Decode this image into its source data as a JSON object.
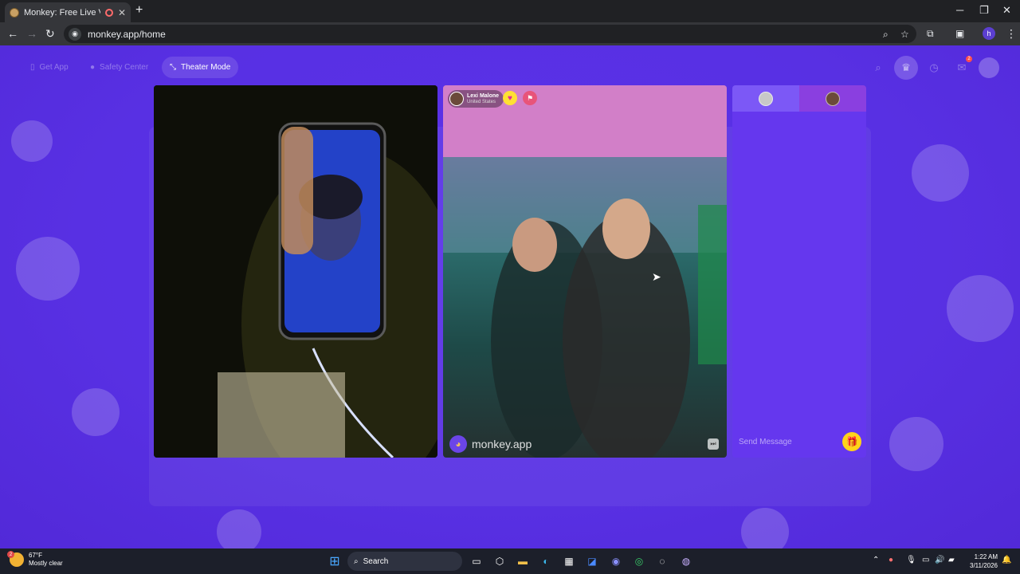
{
  "browser": {
    "tab_title": "Monkey: Free Live Video Ch",
    "tab_close": "✕",
    "new_tab": "+",
    "url": "monkey.app/home",
    "profile_initial": "h",
    "window_controls": [
      "─",
      "❐",
      "✕"
    ]
  },
  "app": {
    "nav": {
      "get_app": "Get App",
      "safety_center": "Safety Center",
      "theater_mode": "Theater Mode"
    },
    "message_badge": "2",
    "partner": {
      "name": "Lexi Malone",
      "country": "United States"
    },
    "watermark": "monkey.app",
    "chat": {
      "placeholder": "Send Message"
    },
    "colors": {
      "background": "#5a31e6",
      "gift": "#ffd31a",
      "heart": "#ffe033"
    }
  },
  "taskbar": {
    "weather_temp": "67°F",
    "weather_desc": "Mostly clear",
    "weather_badge": "2",
    "search_label": "Search",
    "time": "1:22 AM",
    "date": "3/11/2026"
  }
}
